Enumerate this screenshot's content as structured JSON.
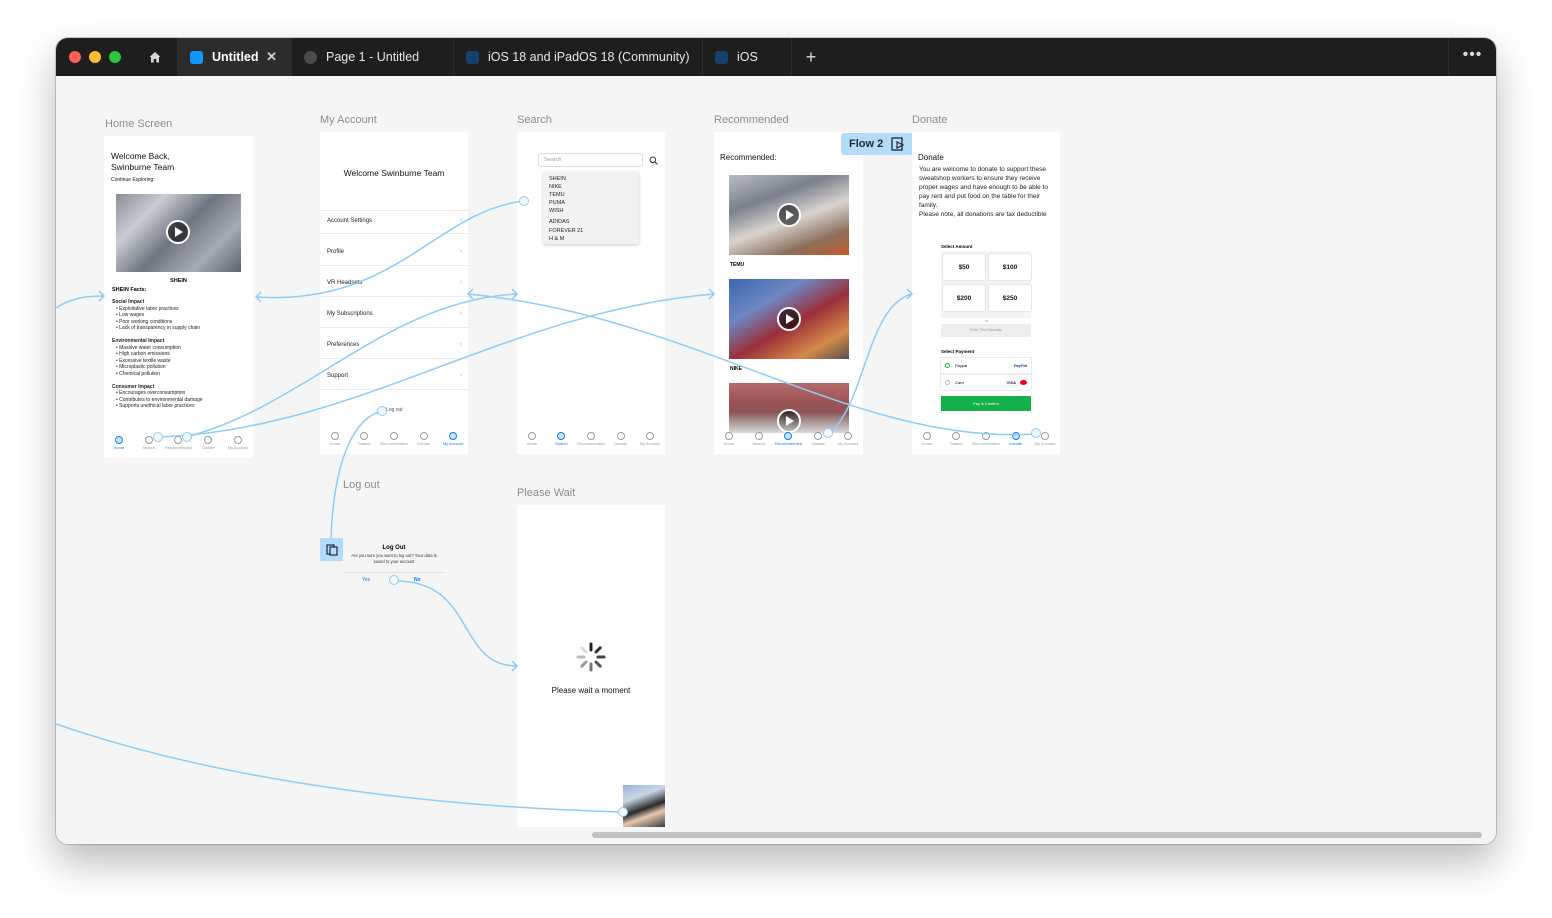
{
  "window": {
    "tabs": [
      {
        "label": "Untitled",
        "close": "✕"
      },
      {
        "label": "Page 1 - Untitled"
      },
      {
        "label": "iOS 18 and iPadOS 18 (Community)"
      },
      {
        "label": "iOS"
      }
    ],
    "add_tab": "+",
    "more": "•••"
  },
  "colors": {
    "accent": "#0a7aff",
    "connector": "#8ecbf8",
    "titlebar": "#1e1e1e",
    "canvas": "#f5f5f5",
    "flow_badge": "#b3dcfb",
    "confirm": "#13b04b"
  },
  "flow_badge": {
    "label": "Flow 2"
  },
  "nav_labels": [
    "Home",
    "Search",
    "Recommended",
    "Donate",
    "My Account"
  ],
  "home": {
    "frame_label": "Home Screen",
    "welcome": "Welcome Back,",
    "name": "Swinburne Team",
    "subtitle": "Continue Exploring:",
    "brand": "SHEIN",
    "facts_title": "SHEIN Facts:",
    "sections": [
      {
        "title": "Social Impact",
        "items": [
          "Exploitative labor practices",
          "Low wages",
          "Poor working conditions",
          "Lack of transparency in supply chain"
        ]
      },
      {
        "title": "Environmental Impact",
        "items": [
          "Massive water consumption",
          "High carbon emissions",
          "Excessive textile waste",
          "Microplastic pollution",
          "Chemical pollution"
        ]
      },
      {
        "title": "Consumer Impact",
        "items": [
          "Encourages overconsumption",
          "Contributes to environmental damage",
          "Supports unethical labor practices"
        ]
      }
    ]
  },
  "account": {
    "frame_label": "My Account",
    "welcome": "Welcome Swinburne Team",
    "items": [
      "Account Settings",
      "Profile",
      "VR Headsets",
      "My Subscriptions",
      "Preferences",
      "Support"
    ],
    "logout": "Log out"
  },
  "search": {
    "frame_label": "Search",
    "placeholder": "Search",
    "results": [
      "SHEIN",
      "NIKE",
      "TEMU",
      "PUMA",
      "WISH",
      "ADIDAS",
      "FOREVER 21",
      "H & M"
    ]
  },
  "recommended": {
    "frame_label": "Recommended",
    "title": "Recommended:",
    "items": [
      "TEMU",
      "NIKE"
    ]
  },
  "donate": {
    "frame_label": "Donate",
    "title": "Donate",
    "body": "You are welcome to donate to support these sweatshop workers to ensure they receive proper wages and have enough to be able to pay rent and put food on the table for their family.",
    "note": "Please note, all donations are tax deductible",
    "select_amount": "Select Amount",
    "amounts": [
      "$50",
      "$100",
      "$200",
      "$250"
    ],
    "or": "or",
    "custom_placeholder": "Enter Print Manually",
    "select_payment": "Select Payment",
    "payments": [
      {
        "label": "Paypal",
        "brand": "PayPal"
      },
      {
        "label": "Card",
        "brand": "VISA"
      }
    ],
    "confirm": "Pay & Confirm"
  },
  "logout_dialog": {
    "frame_label": "Log out",
    "title": "Log Out",
    "message": "Are you sure you want to log out? Your data is saved to your account",
    "yes": "Yes",
    "no": "No"
  },
  "please_wait": {
    "frame_label": "Please Wait",
    "message": "Please wait a moment"
  }
}
